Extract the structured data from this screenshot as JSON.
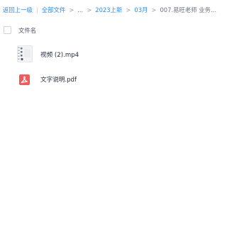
{
  "breadcrumb": {
    "back": "返回上一级",
    "all_files": "全部文件",
    "sep": ">",
    "ellipsis": "...",
    "folder_1": "2023上新",
    "folder_2": "03月",
    "current": "007.易旺老师 业务..."
  },
  "list_header": {
    "name_column": "文件名"
  },
  "files": [
    {
      "name": "视频 (2).mp4",
      "icon": "video-file-icon"
    },
    {
      "name": "文字说明.pdf",
      "icon": "pdf-file-icon"
    }
  ],
  "colors": {
    "link": "#2b8be8",
    "pdf_red": "#f35b5b"
  }
}
